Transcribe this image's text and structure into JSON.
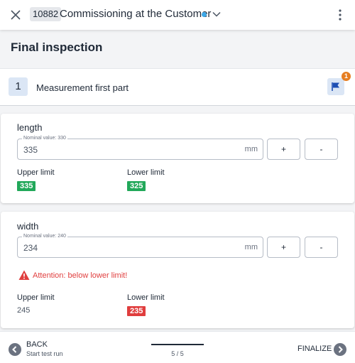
{
  "header": {
    "job_id": "10882",
    "job_title": "Commissioning at the Customer",
    "status_color": "#3da8e8"
  },
  "page": {
    "title": "Final inspection"
  },
  "section": {
    "number": "1",
    "title": "Measurement first part",
    "flag_count": "1",
    "flag_color": "#1e4fb4",
    "badge_color": "#e67e22"
  },
  "measurements": [
    {
      "label": "length",
      "legend": "Nominal value: 330",
      "value": "335",
      "unit": "mm",
      "plus_label": "+",
      "minus_label": "-",
      "upper_label": "Upper limit",
      "upper_value": "335",
      "upper_color": "#22a85a",
      "lower_label": "Lower limit",
      "lower_value": "325",
      "lower_color": "#22a85a"
    },
    {
      "label": "width",
      "legend": "Nominal value: 240",
      "value": "234",
      "unit": "mm",
      "plus_label": "+",
      "minus_label": "-",
      "warning": "Attention: below lower limit!",
      "warning_color": "#e03e3e",
      "upper_label": "Upper limit",
      "upper_value": "245",
      "lower_label": "Lower limit",
      "lower_value": "235",
      "lower_color": "#e03e3e"
    }
  ],
  "footer": {
    "back_label": "BACK",
    "back_sub": "Start test run",
    "page_count": "5 / 5",
    "progress": 1.0,
    "finalize_label": "FINALIZE"
  },
  "icons": {
    "close": "close-icon",
    "chevron": "chevron-down-icon",
    "menu": "kebab-menu-icon",
    "flag": "flag-icon",
    "warning": "warning-icon",
    "back": "arrow-left-icon",
    "forward": "arrow-right-icon"
  }
}
